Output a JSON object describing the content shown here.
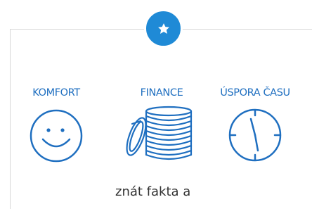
{
  "badge": {
    "icon": "star-icon",
    "color": "#1f8ad6"
  },
  "features": [
    {
      "label": "KOMFORT",
      "icon": "smiley-face-icon"
    },
    {
      "label": "FINANCE",
      "icon": "coin-stack-icon"
    },
    {
      "label": "ÚSPORA ČASU",
      "icon": "clock-icon"
    }
  ],
  "accent_color": "#1f6fc0",
  "body_text": "znát fakta a"
}
